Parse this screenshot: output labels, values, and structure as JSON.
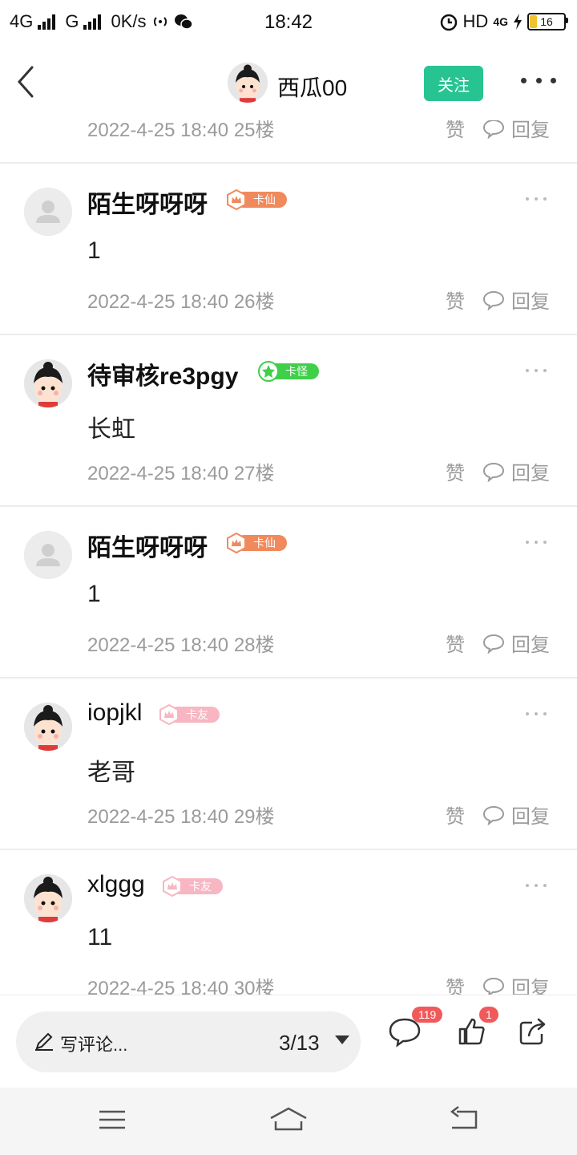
{
  "status_bar": {
    "network_left": "4G",
    "network_mid": "G",
    "speed": "0K/s",
    "time": "18:42",
    "hd": "HD",
    "net_right": "4G",
    "battery": "16",
    "icons": [
      "signal-icon",
      "wifi-hotspot-icon",
      "wechat-icon",
      "alarm-icon",
      "charging-icon",
      "battery-icon"
    ]
  },
  "header": {
    "username": "西瓜00",
    "follow_label": "关注"
  },
  "previous_comment": {
    "meta": "2022-4-25 18:40  25楼",
    "like_label": "赞",
    "reply_label": "回复"
  },
  "comments": [
    {
      "name": "陌生呀呀呀",
      "badge": "卡仙",
      "badge_color": "#f08a5d",
      "avatar": "default",
      "text": "1",
      "meta": "2022-4-25 18:40  26楼",
      "like_label": "赞",
      "reply_label": "回复"
    },
    {
      "name": "待审核re3pgy",
      "badge": "卡怪",
      "badge_color": "#3fcf4a",
      "avatar": "cartoon",
      "text": "长虹",
      "meta": "2022-4-25 18:40  27楼",
      "like_label": "赞",
      "reply_label": "回复"
    },
    {
      "name": "陌生呀呀呀",
      "badge": "卡仙",
      "badge_color": "#f08a5d",
      "avatar": "default",
      "text": "1",
      "meta": "2022-4-25 18:40  28楼",
      "like_label": "赞",
      "reply_label": "回复"
    },
    {
      "name": "iopjkl",
      "badge": "卡友",
      "badge_color": "#f7b6c2",
      "avatar": "cartoon",
      "text": "老哥",
      "meta": "2022-4-25 18:40  29楼",
      "like_label": "赞",
      "reply_label": "回复"
    },
    {
      "name": "xlggg",
      "badge": "卡友",
      "badge_color": "#f7b6c2",
      "avatar": "cartoon",
      "text": "11",
      "meta": "2022-4-25 18:40  30楼",
      "like_label": "赞",
      "reply_label": "回复"
    }
  ],
  "bottom_bar": {
    "write_placeholder": "写评论...",
    "page_indicator": "3/13",
    "comment_count": "119",
    "like_count": "1"
  },
  "colors": {
    "accent": "#27c492",
    "meta_text": "#9b9b9b",
    "count_badge": "#f05a5a"
  }
}
